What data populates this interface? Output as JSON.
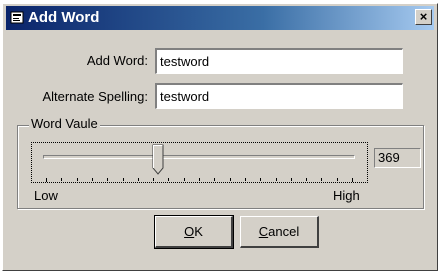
{
  "window": {
    "title": "Add Word",
    "close_glyph": "×"
  },
  "form": {
    "add_word_label": "Add Word:",
    "add_word_value": "testword",
    "alt_spelling_label": "Alternate Spelling:",
    "alt_spelling_value": "testword"
  },
  "slider": {
    "group_title": "Word Vaule",
    "value_text": "369",
    "value_fraction": 0.37,
    "low_label": "Low",
    "high_label": "High",
    "tick_count": 21
  },
  "buttons": {
    "ok": {
      "mnemonic": "O",
      "rest": "K"
    },
    "cancel": {
      "mnemonic": "C",
      "rest": "ancel"
    }
  },
  "icons": {
    "app": "dictionary-icon",
    "close": "close-icon"
  },
  "colors": {
    "face": "#d4d0c8",
    "title_start": "#0a246a",
    "title_end": "#a6caf0"
  }
}
